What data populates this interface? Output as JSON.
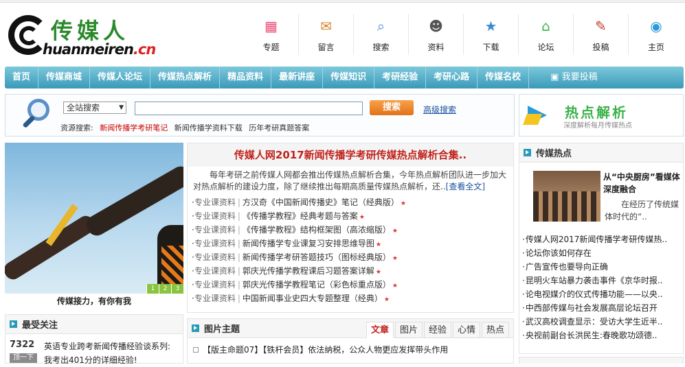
{
  "logo": {
    "cn": "传媒人",
    "py_main": "huanmeiren",
    "py_suffix": ".cn"
  },
  "topnav": [
    {
      "label": "专题",
      "icon": "cubes-icon",
      "color": "#e94e77",
      "glyph": "▦"
    },
    {
      "label": "留言",
      "icon": "cake-icon",
      "color": "#d9822b",
      "glyph": "✉"
    },
    {
      "label": "搜索",
      "icon": "magnifier-icon",
      "color": "#4a90d9",
      "glyph": "⌕"
    },
    {
      "label": "资料",
      "icon": "person-icon",
      "color": "#555555",
      "glyph": "☻"
    },
    {
      "label": "下载",
      "icon": "stars-icon",
      "color": "#3a8ad4",
      "glyph": "★"
    },
    {
      "label": "论坛",
      "icon": "house-icon",
      "color": "#3bb24a",
      "glyph": "⌂"
    },
    {
      "label": "投稿",
      "icon": "book-icon",
      "color": "#c0392b",
      "glyph": "✎"
    },
    {
      "label": "主页",
      "icon": "globe-icon",
      "color": "#2a9ad8",
      "glyph": "◉"
    }
  ],
  "navbar": [
    "首页",
    "传媒商城",
    "传媒人论坛",
    "传媒热点解析",
    "精品资料",
    "最新讲座",
    "传媒知识",
    "考研经验",
    "考研心路",
    "传媒名校"
  ],
  "navbar_submit": "我要投稿",
  "search": {
    "scope": "全站搜索",
    "button": "搜索",
    "advanced": "高级搜索",
    "res_label": "资源搜索:",
    "res_links": [
      "新闻传播学考研笔记",
      "新闻传播学资料下载",
      "历年考研真题答案"
    ]
  },
  "hot_ad": {
    "title": "热点解析",
    "sub": "深度解析每月传媒热点"
  },
  "photo_caption": "传媒接力，有你有我",
  "photo_pager": [
    "1",
    "2",
    "3"
  ],
  "feature": {
    "title": "传媒人网2017新闻传播学考研传媒热点解析合集..",
    "desc": "每年考研之前传媒人网都会推出传媒热点解析合集，今年热点解析团队进一步加大对热点解析的建设力度，除了继续推出每期高质量传媒热点解析，还..",
    "more": "[查看全文]",
    "items": [
      {
        "cat": "专业课资料",
        "text": "方汉奇《中国新闻传播史》笔记（经典版）"
      },
      {
        "cat": "专业课资料",
        "text": "《传播学教程》经典考题与答案"
      },
      {
        "cat": "专业课资料",
        "text": "《传播学教程》结构框架图（高浓缩版）"
      },
      {
        "cat": "专业课资料",
        "text": "新闻传播学专业课复习安排思维导图"
      },
      {
        "cat": "专业课资料",
        "text": "新闻传播学考研答题技巧（图标经典版）"
      },
      {
        "cat": "专业课资料",
        "text": "郭庆光传播学教程课后习题答案详解"
      },
      {
        "cat": "专业课资料",
        "text": "郭庆光传播学教程笔记（彩色标重点版）"
      },
      {
        "cat": "专业课资料",
        "text": "中国新闻事业史四大专题整理（经典）"
      }
    ]
  },
  "hot": {
    "title": "传媒热点",
    "pic_title": "从“中央厨房”看媒体深度融合",
    "pic_desc": "在经历了传统媒体时代的“..",
    "items": [
      "传媒人网2017新闻传播学考研传媒热..",
      "论坛你该如何存在",
      "广告宣传也要导向正确",
      "昆明火车站暴力袭击事件《京华时报..",
      "论电视媒介的仪式传播功能——以央..",
      "中西部传媒与社会发展高层论坛召开",
      "武汉高校调查显示：受访大学生近半..",
      "央视前副台长洪民生:春晚歌功颂德.."
    ]
  },
  "focus": {
    "title": "最受关注",
    "num": "7322",
    "label": "顶一下",
    "text": "英语专业跨考新闻传播经验谈系列:我考出401分的详细经验!"
  },
  "pics": {
    "title": "图片主题",
    "tabs": [
      "文章",
      "图片",
      "经验",
      "心情",
      "热点"
    ],
    "row": "【版主命题07】【铁杆会员】依法纳税，公众人物更应发挥带头作用"
  }
}
